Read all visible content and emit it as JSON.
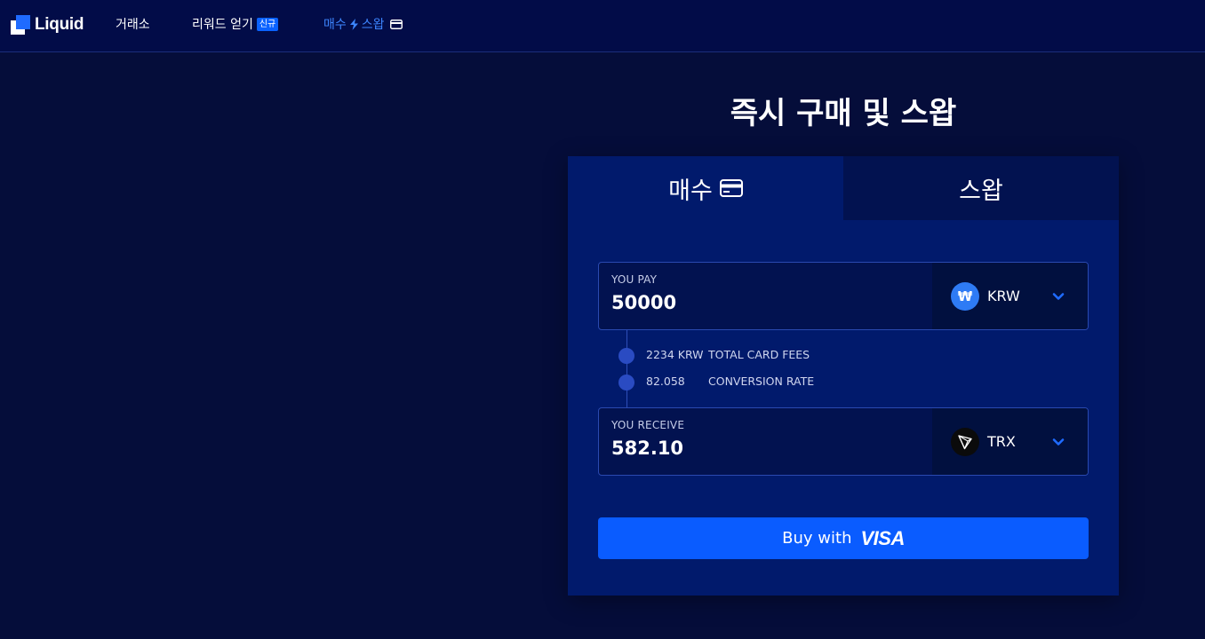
{
  "brand": {
    "name": "Liquid"
  },
  "nav": {
    "exchange": "거래소",
    "rewards": "리워드 얻기",
    "rewards_badge": "신규",
    "buy_swap_buy": "매수",
    "buy_swap_swap": "스왑"
  },
  "main": {
    "title": "즉시 구매 및 스왑",
    "tabs": {
      "buy": "매수",
      "swap": "스왑"
    },
    "pay": {
      "label": "YOU PAY",
      "value": "50000",
      "currency": "KRW",
      "currency_symbol": "₩",
      "currency_color": "#2e7bf5"
    },
    "fees": {
      "card_fee_value": "2234 KRW",
      "card_fee_label": "TOTAL CARD FEES",
      "rate_value": "82.058",
      "rate_label": "CONVERSION RATE"
    },
    "receive": {
      "label": "YOU RECEIVE",
      "value": "582.10",
      "currency": "TRX",
      "currency_icon": "tron-icon"
    },
    "buy_button": {
      "label": "Buy with",
      "brand": "VISA"
    }
  },
  "colors": {
    "accent": "#0a5cff",
    "background": "#050d3a",
    "card": "#011a6c"
  }
}
